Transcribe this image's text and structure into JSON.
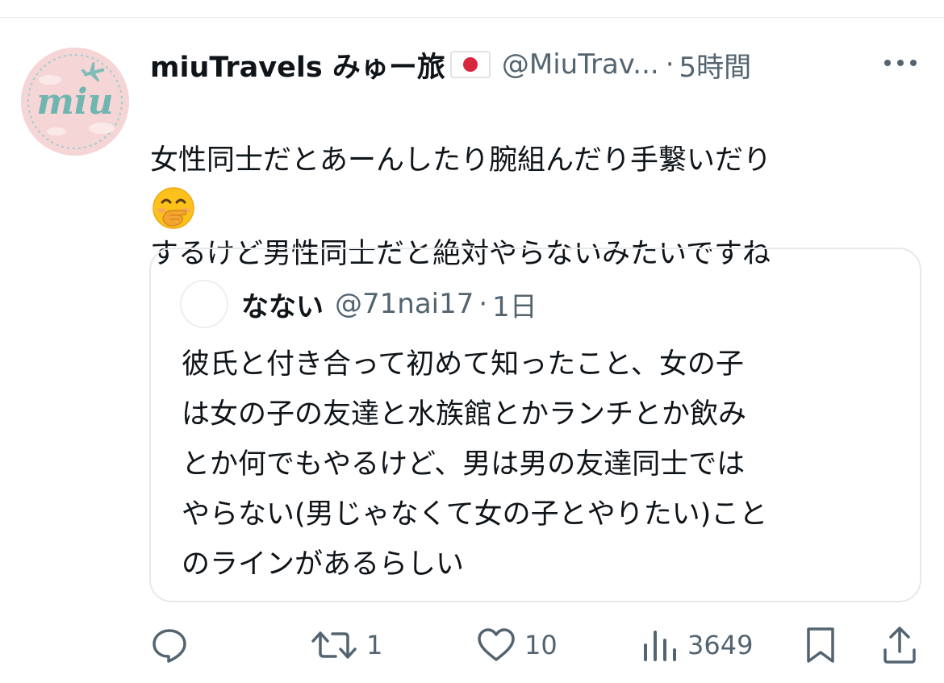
{
  "tweet": {
    "avatar_text": "miu",
    "display_name": "miuTravels みゅー旅",
    "flag": "japan-flag-icon",
    "handle": "@MiuTrav...",
    "separator": "·",
    "time": "5時間",
    "text_lines": [
      "女性同士だとあーんしたり腕組んだり手繋いだり",
      "するけど男性同士だと絶対やらないみたいですね"
    ],
    "emoji": "face-with-hand-over-mouth-icon"
  },
  "quote": {
    "name": "なない",
    "handle": "@71nai17",
    "separator": "·",
    "time": "1日",
    "text_lines": [
      "彼氏と付き合って初めて知ったこと、女の子",
      "は女の子の友達と水族館とかランチとか飲み",
      "とか何でもやるけど、男は男の友達同士では",
      "やらない(男じゃなくて女の子とやりたい)こと",
      "のラインがあるらしい"
    ]
  },
  "actions": {
    "reply_count": "",
    "retweet_count": "1",
    "like_count": "10",
    "view_count": "3649"
  },
  "colors": {
    "text": "#0f1419",
    "secondary": "#536471",
    "border": "#e6e9ec",
    "avatar_bg": "#f5d5d6",
    "avatar_text": "#6fb5b0"
  }
}
